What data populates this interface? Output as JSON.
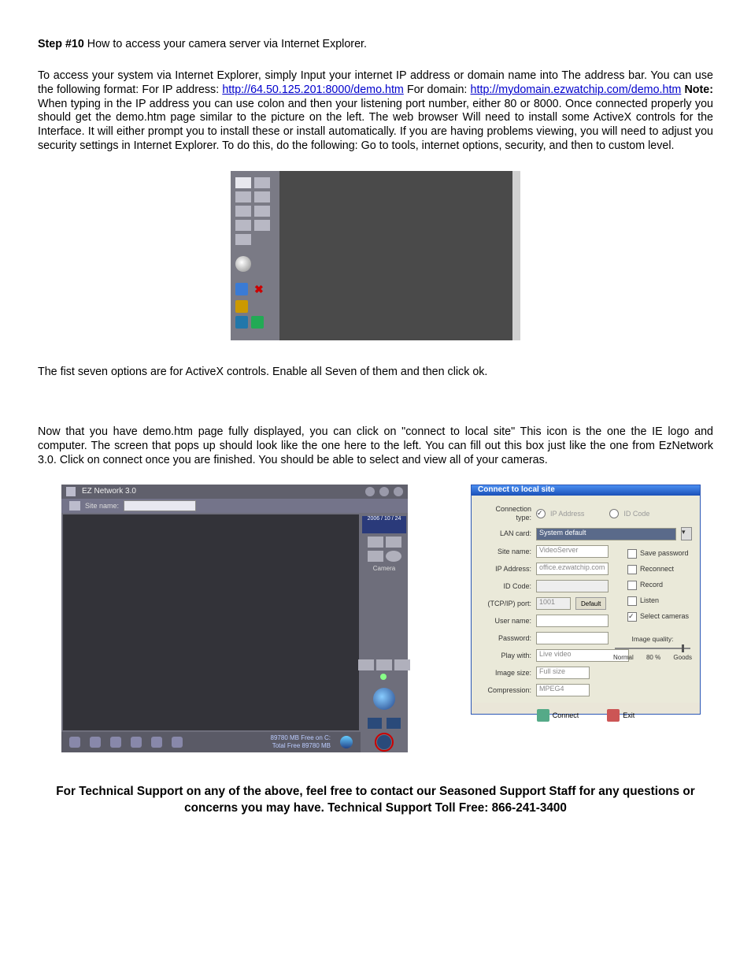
{
  "step": {
    "label": "Step #10",
    "title_rest": " How to access your camera server via Internet Explorer."
  },
  "para1": {
    "t1": "To access your system via Internet Explorer, simply Input your internet IP address or domain name into The address bar. You can use the following format: For IP address: ",
    "link1": "http://64.50.125.201:8000/demo.htm",
    "t2": " For domain: ",
    "link2": "http://mydomain.ezwatchip.com/demo.htm",
    "note": " Note: ",
    "t3": "When typing in the IP address you can use colon and then your listening port number, either 80 or 8000. Once connected properly you should get the demo.htm page similar to the picture on the left. The web browser Will need to install some ActiveX controls for the Interface. It will either prompt you to install these or install automatically. If you are having problems viewing, you will need to adjust you security settings in Internet Explorer.  To do this, do the following:  Go to tools, internet options, security, and then to custom level."
  },
  "para2": "The fist seven options are for ActiveX controls. Enable all Seven of them and then click ok.",
  "para3": "Now that you have demo.htm page fully displayed, you can click on \"connect to local site\" This icon is the one the IE logo and computer. The screen that pops up should look like the one here to the left.  You can fill out this box just like the one from EzNetwork 3.0. Click on connect once you are finished. You should be able to select and view all of your cameras.",
  "eznet": {
    "title": "EZ Network 3.0",
    "site_label": "Site name:",
    "date": "2006 / 10 / 24",
    "camera": "Camera",
    "status_free": "89780 MB Free on C:",
    "status_total": "Total Free 89780 MB"
  },
  "dialog": {
    "title": "Connect to local site",
    "conn_type_label": "Connection type:",
    "radio_ip": "IP Address",
    "radio_id": "ID Code",
    "lan_label": "LAN card:",
    "lan_value": "System default",
    "site_label": "Site name:",
    "site_value": "VideoServer",
    "ip_label": "IP Address:",
    "ip_value": "office.ezwatchip.com",
    "idcode_label": "ID Code:",
    "port_label": "(TCP/IP) port:",
    "port_value": "1001",
    "port_default_btn": "Default",
    "user_label": "User name:",
    "pass_label": "Password:",
    "play_label": "Play with:",
    "play_value": "Live video",
    "size_label": "Image size:",
    "size_value": "Full size",
    "comp_label": "Compression:",
    "comp_value": "MPEG4",
    "chk_savepw": "Save password",
    "chk_reconnect": "Reconnect",
    "chk_record": "Record",
    "chk_listen": "Listen",
    "chk_selcam": "Select cameras",
    "quality_title": "Image quality:",
    "quality_normal": "Normal",
    "quality_pct": "80 %",
    "quality_good": "Goods",
    "btn_connect": "Connect",
    "btn_exit": "Exit"
  },
  "support": {
    "line1": "For Technical Support on any of the above, feel free to contact our Seasoned Support Staff for any questions or concerns you may have. Technical Support Toll Free: 866-241-3400"
  }
}
